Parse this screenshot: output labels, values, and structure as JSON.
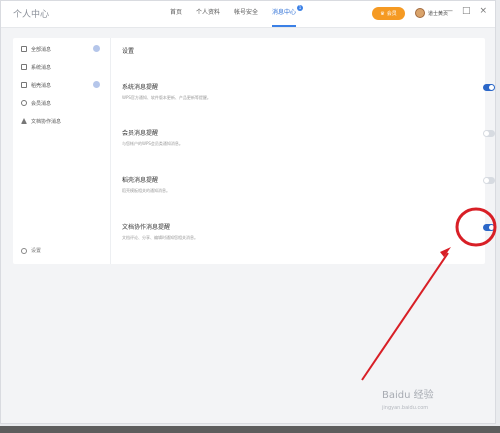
{
  "header": {
    "app_title": "个人中心",
    "tabs": [
      {
        "label": "首页",
        "active": false
      },
      {
        "label": "个人资料",
        "active": false
      },
      {
        "label": "帐号安全",
        "active": false
      },
      {
        "label": "消息中心",
        "active": true,
        "badge": "1"
      }
    ],
    "vip_label": "会员",
    "username": "道士黄页",
    "window_controls": [
      "—",
      "□",
      "×"
    ]
  },
  "sidebar": {
    "items": [
      {
        "label": "全部消息",
        "icon": "inbox-icon",
        "badge": true
      },
      {
        "label": "系统消息",
        "icon": "monitor-icon",
        "badge": false
      },
      {
        "label": "稻壳消息",
        "icon": "docer-icon",
        "badge": true
      },
      {
        "label": "会员消息",
        "icon": "member-icon",
        "badge": false
      },
      {
        "label": "文档协作消息",
        "icon": "triangle-icon",
        "badge": false
      }
    ],
    "settings_label": "设置"
  },
  "content": {
    "title": "设置",
    "settings": [
      {
        "title": "系统消息提醒",
        "desc": "WPS官方通知、软件版本更新、产品更新等提醒。",
        "on": true
      },
      {
        "title": "会员消息提醒",
        "desc": "与您帐户的WPS会员类通知消息。",
        "on": false
      },
      {
        "title": "稻壳消息提醒",
        "desc": "稻壳模板相关的通知消息。",
        "on": false
      },
      {
        "title": "文档协作消息提醒",
        "desc": "文档评论、分享、编辑时通知您相关消息。",
        "on": true
      }
    ]
  },
  "annotation": {
    "color": "#d81f26"
  },
  "watermark": {
    "text": "Baidu 经验",
    "sub": "jingyan.baidu.com"
  }
}
